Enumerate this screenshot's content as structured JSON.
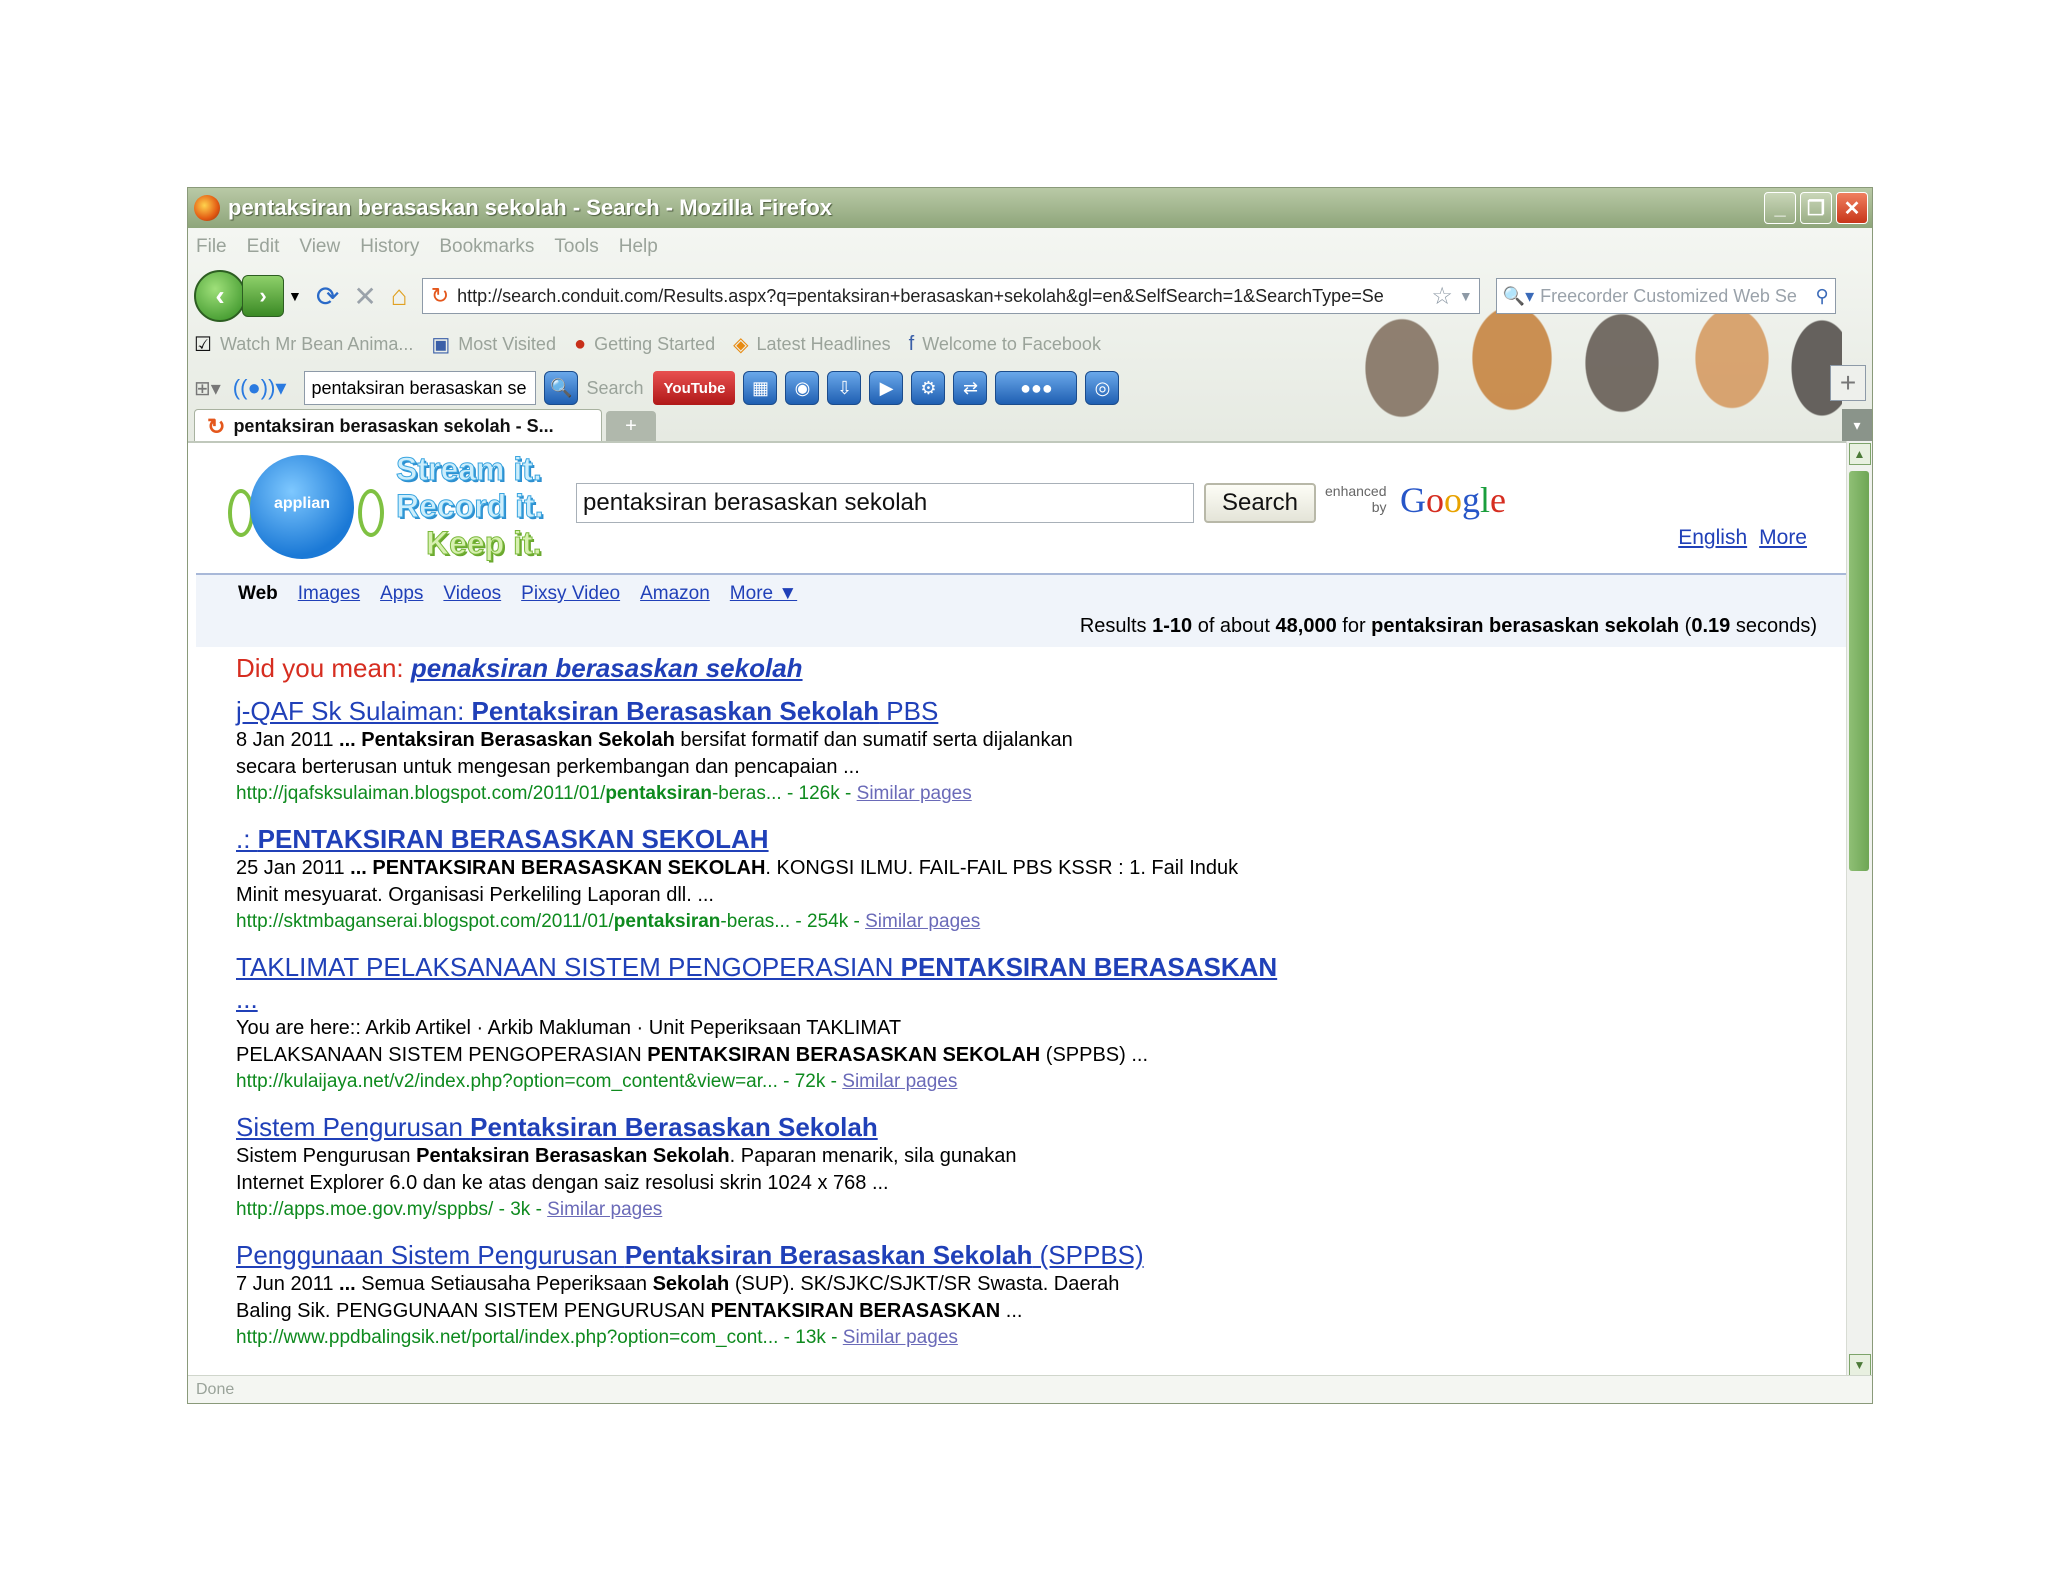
{
  "window": {
    "title": "pentaksiran berasaskan sekolah - Search - Mozilla Firefox"
  },
  "menu": [
    "File",
    "Edit",
    "View",
    "History",
    "Bookmarks",
    "Tools",
    "Help"
  ],
  "nav": {
    "url": "http://search.conduit.com/Results.aspx?q=pentaksiran+berasaskan+sekolah&gl=en&SelfSearch=1&SearchType=Se",
    "search_placeholder": "Freecorder Customized Web Se"
  },
  "bookmarks": [
    "Watch Mr Bean Anima...",
    "Most Visited",
    "Getting Started",
    "Latest Headlines",
    "Welcome to Facebook"
  ],
  "toolbar": {
    "query": "pentaksiran berasaskan se",
    "search_label": "Search",
    "youtube_label": "YouTube"
  },
  "tab": {
    "label": "pentaksiran berasaskan sekolah - S..."
  },
  "status": "Done",
  "page": {
    "logo_word": "applian",
    "slogan": [
      "Stream it.",
      "Record it.",
      "Keep it."
    ],
    "query": "pentaksiran berasaskan sekolah",
    "search_button": "Search",
    "enhanced": [
      "enhanced",
      "by"
    ],
    "google": [
      "G",
      "o",
      "o",
      "g",
      "l",
      "e"
    ],
    "lang_english": "English",
    "lang_more": "More",
    "vtabs": [
      "Web",
      "Images",
      "Apps",
      "Videos",
      "Pixsy Video",
      "Amazon",
      "More ▼"
    ],
    "results_info": {
      "prefix": "Results ",
      "range": "1-10",
      "mid": " of about ",
      "count": "48,000",
      "for": " for ",
      "query": "pentaksiran berasaskan sekolah",
      "time_open": " (",
      "time": "0.19",
      "time_close": " seconds)"
    },
    "did_you_mean": {
      "label": "Did you mean: ",
      "suggestion": "penaksiran berasaskan sekolah"
    },
    "similar": "Similar pages",
    "results": [
      {
        "t1": "j-QAF Sk Sulaiman: ",
        "t2": "Pentaksiran Berasaskan Sekolah",
        "t3": " PBS",
        "s1a": "8 Jan 2011 ",
        "s1b": "... Pentaksiran Berasaskan Sekolah",
        "s1c": " bersifat formatif dan sumatif serta dijalankan",
        "s2": "secara berterusan untuk mengesan perkembangan dan pencapaian ...",
        "u1": "http://jqafsksulaiman.blogspot.com/2011/01/",
        "u2": "pentaksiran",
        "u3": "-beras... - 126k - "
      },
      {
        "t1": ".: ",
        "t2": "PENTAKSIRAN BERASASKAN SEKOLAH",
        "t3": "",
        "s1a": "25 Jan 2011 ",
        "s1b": "... PENTAKSIRAN BERASASKAN SEKOLAH",
        "s1c": ". KONGSI ILMU. FAIL-FAIL PBS KSSR : 1. Fail Induk",
        "s2": "Minit mesyuarat. Organisasi Perkeliling Laporan dll. ...",
        "u1": "http://sktmbaganserai.blogspot.com/2011/01/",
        "u2": "pentaksiran",
        "u3": "-beras... - 254k - "
      },
      {
        "t1": "TAKLIMAT PELAKSANAAN SISTEM PENGOPERASIAN ",
        "t2": "PENTAKSIRAN BERASASKAN",
        "t3": " ...",
        "s1a": "You are here:: Arkib Artikel · Arkib Makluman · Unit Peperiksaan TAKLIMAT",
        "s1b": "",
        "s1c": "",
        "s2a": "PELAKSANAAN SISTEM PENGOPERASIAN ",
        "s2b": "PENTAKSIRAN BERASASKAN SEKOLAH",
        "s2c": " (SPPBS) ...",
        "u1": "http://kulaijaya.net/v2/index.php?option=com_content&view=ar... - 72k - ",
        "u2": "",
        "u3": ""
      },
      {
        "t1": "Sistem Pengurusan ",
        "t2": "Pentaksiran Berasaskan Sekolah",
        "t3": "",
        "s1a": "Sistem Pengurusan ",
        "s1b": "Pentaksiran Berasaskan Sekolah",
        "s1c": ". Paparan menarik, sila gunakan",
        "s2": "Internet Explorer 6.0 dan ke atas dengan saiz resolusi skrin 1024 x 768 ...",
        "u1": "http://apps.moe.gov.my/sppbs/ - 3k - ",
        "u2": "",
        "u3": ""
      },
      {
        "t1": "Penggunaan Sistem Pengurusan ",
        "t2": "Pentaksiran Berasaskan Sekolah",
        "t3": " (SPPBS)",
        "s1a": "7 Jun 2011 ",
        "s1b": "...",
        "s1c": " Semua Setiausaha Peperiksaan ",
        "s1d": "Sekolah",
        "s1e": " (SUP). SK/SJKC/SJKT/SR Swasta. Daerah",
        "s2a": "Baling Sik. PENGGUNAAN SISTEM PENGURUSAN ",
        "s2b": "PENTAKSIRAN BERASASKAN",
        "s2c": " ...",
        "u1": "http://www.ppdbalingsik.net/portal/index.php?option=com_cont... - 13k - ",
        "u2": "",
        "u3": ""
      }
    ]
  }
}
